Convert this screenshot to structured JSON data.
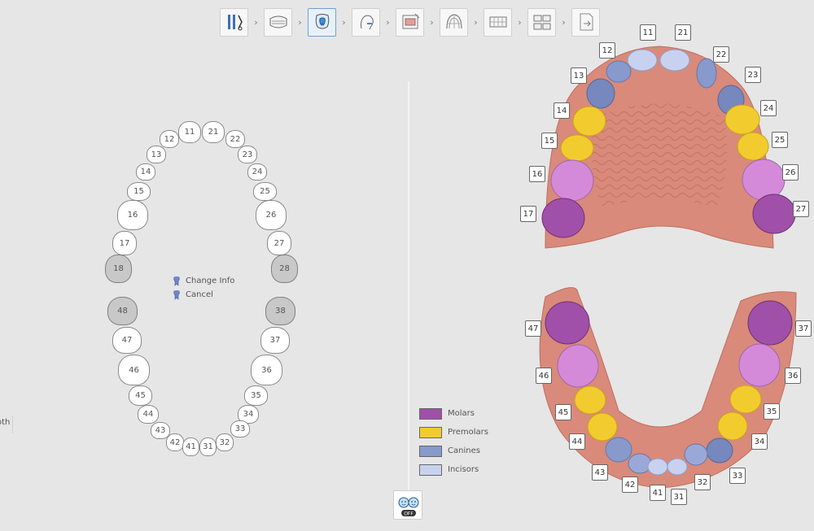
{
  "workflow": {
    "steps": [
      {
        "icon": "scan-tools-icon",
        "active": false
      },
      {
        "icon": "arch-model-icon",
        "active": false
      },
      {
        "icon": "tooth-segmentation-icon",
        "active": true
      },
      {
        "icon": "face-profile-icon",
        "active": false
      },
      {
        "icon": "photo-alignment-icon",
        "active": false
      },
      {
        "icon": "arch-grid-icon",
        "active": false
      },
      {
        "icon": "bite-setup-icon",
        "active": false
      },
      {
        "icon": "split-stages-icon",
        "active": false
      },
      {
        "icon": "export-document-icon",
        "active": false
      }
    ],
    "arrow": "›"
  },
  "tooth_chart": {
    "teeth": [
      {
        "num": "11",
        "state": "present"
      },
      {
        "num": "21",
        "state": "present"
      },
      {
        "num": "12",
        "state": "present"
      },
      {
        "num": "22",
        "state": "present"
      },
      {
        "num": "13",
        "state": "present"
      },
      {
        "num": "23",
        "state": "present"
      },
      {
        "num": "14",
        "state": "present"
      },
      {
        "num": "24",
        "state": "present"
      },
      {
        "num": "15",
        "state": "present"
      },
      {
        "num": "25",
        "state": "present"
      },
      {
        "num": "16",
        "state": "present"
      },
      {
        "num": "26",
        "state": "present"
      },
      {
        "num": "17",
        "state": "present"
      },
      {
        "num": "27",
        "state": "present"
      },
      {
        "num": "18",
        "state": "missing"
      },
      {
        "num": "28",
        "state": "missing"
      },
      {
        "num": "48",
        "state": "missing"
      },
      {
        "num": "38",
        "state": "missing"
      },
      {
        "num": "47",
        "state": "present"
      },
      {
        "num": "37",
        "state": "present"
      },
      {
        "num": "46",
        "state": "present"
      },
      {
        "num": "36",
        "state": "present"
      },
      {
        "num": "45",
        "state": "present"
      },
      {
        "num": "35",
        "state": "present"
      },
      {
        "num": "44",
        "state": "present"
      },
      {
        "num": "34",
        "state": "present"
      },
      {
        "num": "43",
        "state": "present"
      },
      {
        "num": "33",
        "state": "present"
      },
      {
        "num": "42",
        "state": "present"
      },
      {
        "num": "32",
        "state": "present"
      },
      {
        "num": "41",
        "state": "present"
      },
      {
        "num": "31",
        "state": "present"
      }
    ]
  },
  "context_menu": {
    "change_info": "Change Info",
    "cancel": "Cancel"
  },
  "side_panel_label": "oth",
  "legend": [
    {
      "label": "Molars",
      "color": "#a050a8"
    },
    {
      "label": "Premolars",
      "color": "#f2cc2e"
    },
    {
      "label": "Canines",
      "color": "#8899cc"
    },
    {
      "label": "Incisors",
      "color": "#c8d2f0"
    }
  ],
  "mode_button": {
    "label": "OFF"
  },
  "arches": {
    "gum_color": "#d98a7a",
    "upper_labels": [
      "11",
      "21",
      "12",
      "22",
      "13",
      "23",
      "14",
      "24",
      "15",
      "25",
      "16",
      "26",
      "17",
      "27"
    ],
    "lower_labels": [
      "47",
      "37",
      "46",
      "36",
      "45",
      "35",
      "44",
      "34",
      "43",
      "33",
      "42",
      "32",
      "41",
      "31"
    ]
  }
}
